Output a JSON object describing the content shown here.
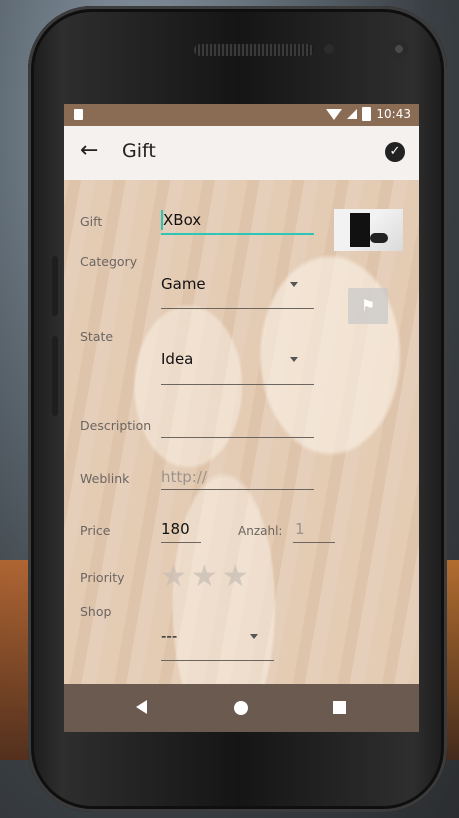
{
  "status_bar": {
    "time": "10:43"
  },
  "app_bar": {
    "back_icon": "arrow-left-icon",
    "title": "Gift",
    "save_icon": "check-circle-icon"
  },
  "form": {
    "gift": {
      "label": "Gift",
      "value": "XBox"
    },
    "category": {
      "label": "Category",
      "value": "Game"
    },
    "state": {
      "label": "State",
      "value": "Idea"
    },
    "description": {
      "label": "Description",
      "value": ""
    },
    "weblink": {
      "label": "Weblink",
      "placeholder": "http://"
    },
    "price": {
      "label": "Price",
      "value": "180"
    },
    "anzahl": {
      "label": "Anzahl:",
      "placeholder": "1"
    },
    "priority": {
      "label": "Priority",
      "stars_total": 3,
      "stars_selected": 0
    },
    "shop": {
      "label": "Shop",
      "value": "---"
    }
  },
  "nav_bar": {
    "back_icon": "nav-back-icon",
    "home_icon": "nav-home-icon",
    "recent_icon": "nav-recent-icon"
  },
  "colors": {
    "accent": "#2ec4b6",
    "status_bar": "#8a6c55",
    "app_bar": "#f4f1ee"
  }
}
